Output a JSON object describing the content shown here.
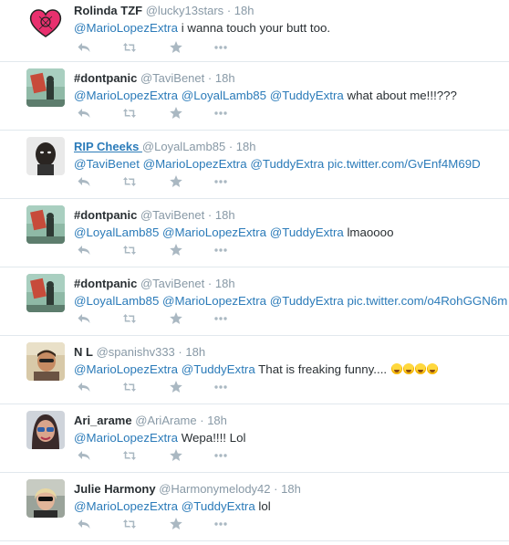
{
  "colors": {
    "link": "#2b7bb9",
    "meta": "#8899a6",
    "icon": "#aab8c2",
    "border": "#e1e8ed"
  },
  "icons": [
    "reply-icon",
    "retweet-icon",
    "favorite-icon",
    "more-icon"
  ],
  "tweets": [
    {
      "name": "Rolinda TZF",
      "handle": "@lucky13stars",
      "sep": "·",
      "time": "18h",
      "segments": [
        {
          "t": "mention",
          "v": "@MarioLopezExtra"
        },
        {
          "t": "text",
          "v": " i wanna touch your butt too."
        }
      ]
    },
    {
      "name": "#dontpanic",
      "handle": "@TaviBenet",
      "sep": "·",
      "time": "18h",
      "segments": [
        {
          "t": "mention",
          "v": "@MarioLopezExtra"
        },
        {
          "t": "text",
          "v": " "
        },
        {
          "t": "mention",
          "v": "@LoyalLamb85"
        },
        {
          "t": "text",
          "v": " "
        },
        {
          "t": "mention",
          "v": "@TuddyExtra"
        },
        {
          "t": "text",
          "v": " what about me!!!???"
        }
      ]
    },
    {
      "name": "RIP Cheeks ",
      "handle": "@LoyalLamb85",
      "sep": "·",
      "time": "18h",
      "name_link": true,
      "segments": [
        {
          "t": "mention",
          "v": "@TaviBenet"
        },
        {
          "t": "text",
          "v": " "
        },
        {
          "t": "mention",
          "v": "@MarioLopezExtra"
        },
        {
          "t": "text",
          "v": " "
        },
        {
          "t": "mention",
          "v": "@TuddyExtra"
        },
        {
          "t": "text",
          "v": " "
        },
        {
          "t": "url",
          "v": "pic.twitter.com/GvEnf4M69D"
        }
      ]
    },
    {
      "name": "#dontpanic",
      "handle": "@TaviBenet",
      "sep": "·",
      "time": "18h",
      "segments": [
        {
          "t": "mention",
          "v": "@LoyalLamb85"
        },
        {
          "t": "text",
          "v": " "
        },
        {
          "t": "mention",
          "v": "@MarioLopezExtra"
        },
        {
          "t": "text",
          "v": " "
        },
        {
          "t": "mention",
          "v": "@TuddyExtra"
        },
        {
          "t": "text",
          "v": " lmaoooo"
        }
      ]
    },
    {
      "name": "#dontpanic",
      "handle": "@TaviBenet",
      "sep": "·",
      "time": "18h",
      "segments": [
        {
          "t": "mention",
          "v": "@LoyalLamb85"
        },
        {
          "t": "text",
          "v": " "
        },
        {
          "t": "mention",
          "v": "@MarioLopezExtra"
        },
        {
          "t": "text",
          "v": " "
        },
        {
          "t": "mention",
          "v": "@TuddyExtra"
        },
        {
          "t": "text",
          "v": " "
        },
        {
          "t": "url",
          "v": "pic.twitter.com/o4RohGGN6m"
        }
      ]
    },
    {
      "name": "N L",
      "handle": "@spanishv333",
      "sep": "·",
      "time": "18h",
      "segments": [
        {
          "t": "mention",
          "v": "@MarioLopezExtra"
        },
        {
          "t": "text",
          "v": " "
        },
        {
          "t": "mention",
          "v": "@TuddyExtra"
        },
        {
          "t": "text",
          "v": " That is freaking funny.... "
        },
        {
          "t": "emoji",
          "count": 4
        }
      ]
    },
    {
      "name": "Ari_arame",
      "handle": "@AriArame",
      "sep": "·",
      "time": "18h",
      "segments": [
        {
          "t": "mention",
          "v": "@MarioLopezExtra"
        },
        {
          "t": "text",
          "v": " Wepa!!!! Lol"
        }
      ]
    },
    {
      "name": "Julie Harmony",
      "handle": "@Harmonymelody42",
      "sep": "·",
      "time": "18h",
      "segments": [
        {
          "t": "mention",
          "v": "@MarioLopezExtra"
        },
        {
          "t": "text",
          "v": " "
        },
        {
          "t": "mention",
          "v": "@TuddyExtra"
        },
        {
          "t": "text",
          "v": " lol"
        }
      ]
    }
  ]
}
